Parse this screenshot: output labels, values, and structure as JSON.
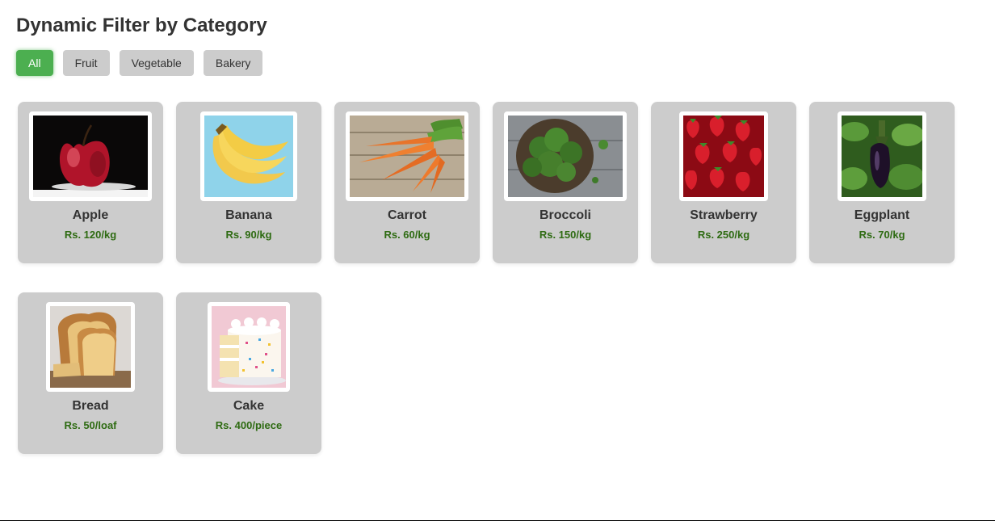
{
  "page": {
    "title": "Dynamic Filter by Category"
  },
  "filters": {
    "active": "All",
    "buttons": [
      {
        "label": "All"
      },
      {
        "label": "Fruit"
      },
      {
        "label": "Vegetable"
      },
      {
        "label": "Bakery"
      }
    ]
  },
  "products": [
    {
      "name": "Apple",
      "price": "Rs. 120/kg",
      "image": "apple-photo"
    },
    {
      "name": "Banana",
      "price": "Rs. 90/kg",
      "image": "banana-photo"
    },
    {
      "name": "Carrot",
      "price": "Rs. 60/kg",
      "image": "carrot-photo"
    },
    {
      "name": "Broccoli",
      "price": "Rs. 150/kg",
      "image": "broccoli-photo"
    },
    {
      "name": "Strawberry",
      "price": "Rs. 250/kg",
      "image": "strawberry-photo"
    },
    {
      "name": "Eggplant",
      "price": "Rs. 70/kg",
      "image": "eggplant-photo"
    },
    {
      "name": "Bread",
      "price": "Rs. 50/loaf",
      "image": "bread-photo"
    },
    {
      "name": "Cake",
      "price": "Rs. 400/piece",
      "image": "cake-photo"
    }
  ],
  "colors": {
    "accent": "#4caf50",
    "card_bg": "#cccccc",
    "price": "#2e6b12",
    "text": "#333333"
  }
}
